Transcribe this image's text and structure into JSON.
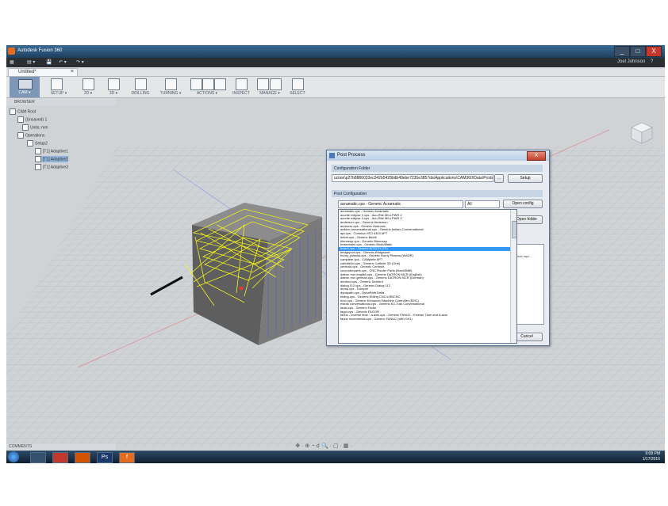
{
  "window": {
    "title": "Autodesk Fusion 360",
    "user": "Joel Johnson",
    "help": "?",
    "minimize": "_",
    "maximize": "□",
    "close": "X"
  },
  "menubar": {
    "grid": "▦",
    "file": "▤ ▾",
    "save": "💾",
    "undo": "↶ ▾",
    "redo": "↷ ▾"
  },
  "document_tab": {
    "label": "Untitled*",
    "close": "×"
  },
  "ribbon": {
    "workspace": "CAM ▾",
    "groups": [
      {
        "name": "setup",
        "label": "SETUP ▾"
      },
      {
        "name": "2d",
        "label": "2D ▾"
      },
      {
        "name": "3d",
        "label": "3D ▾"
      },
      {
        "name": "drilling",
        "label": "DRILLING"
      },
      {
        "name": "turning",
        "label": "TURNING ▾"
      },
      {
        "name": "actions",
        "label": "ACTIONS ▾"
      },
      {
        "name": "inspect",
        "label": "INSPECT"
      },
      {
        "name": "manage",
        "label": "MANAGE ▾"
      },
      {
        "name": "select",
        "label": "SELECT"
      }
    ]
  },
  "browser": {
    "title": "BROWSER",
    "items": [
      {
        "label": "CAM Root"
      },
      {
        "label": "(Unsaved) 1"
      },
      {
        "label": "Units: mm"
      },
      {
        "label": "Operations"
      },
      {
        "label": "Setup2"
      },
      {
        "label": "[T1] Adaptive1"
      },
      {
        "label": "[T1] Adaptive2"
      },
      {
        "label": "[T1] Adaptive3"
      }
    ]
  },
  "comments": {
    "label": "COMMENTS"
  },
  "navbar": {
    "tools": "✥ · ⊕ ◔ ☌ 🔍 · ▢ · ▦ ·"
  },
  "dialog": {
    "title": "Post Process",
    "close": "X",
    "config_folder_header": "Configuration Folder",
    "config_folder_path": "uction\\p27b8886033ec042b5428bdb49ebe7235e3857da\\Applications\\CAM360\\Data\\Posts",
    "browse_label": "...",
    "setup_button": "Setup",
    "post_config_header": "Post Configuration",
    "selected_config": "acramatic.cps - Generic Acramatic",
    "filter": "All",
    "open_config_button": "Open config",
    "open_folder_button": "Open folder",
    "side_text": "serve rapi...",
    "cancel_button": "Cancel",
    "options": [
      "acramatic.cps - Generic Acramatic",
      "acurite millpwr 2.cps - Acu-Rite MILLPWR 2",
      "acurite millpwr 3.cps - Acu-Rite MILLPWR 3",
      "anderson.cps - Generic Anderson",
      "andronic.cps - Generic Andronic",
      "anilam conversational.cps - Generic Anilam Conversational",
      "apt.cps - Common ISO 4343 APT",
      "beloit.cps - Generic Beloit",
      "biennesp.cps - Generic Biennesp",
      "bostomatic.cps - Generic BostoMatic",
      "bosch.cps - Generic BOSCH (TS)",
      "bridgeport.cps - Generic Bridgeport",
      "burny_plasma.cps - Generic Burny Plasma (WADR)",
      "camplete.cps - CAMplete APT",
      "carbide3d.cps - Generic Carbide 3D (Grbl)",
      "centroid.cps - Generic Centroid",
      "cncrouterparts.cps - CNC Router Parts (Mach3Mill)",
      "datron mcr english.cps - Generic DATRON MCR (English)",
      "datron mcr german.cps - Generic DATRON MCR (German)",
      "denford.cps - Generic Denford",
      "dialog 112.cps - Generic Dialog 112",
      "dump.cps - Dumper",
      "dynapath.cps - DynaPath Delta",
      "ebling.cps - Generic Ebling CNC/USBCNC",
      "emc.cps - Generic Enhanced Machine Controller (EMC)",
      "estrak conversational.cps - Generic EZ-Trak Conversational",
      "fadal.cps - Generic Fadal",
      "fagor.cps - Generic FAGOR",
      "fanuc - inverse time - a-axis.cps - Generic FANUC - Inverse Time and A-axis",
      "fanuc incremental.cps - Generic FANUC (with G91)"
    ],
    "selected_option_index": 10
  },
  "taskbar": {
    "apps": [
      "",
      "",
      "",
      "Ps",
      "f"
    ],
    "time": "9:08 PM",
    "date": "1/17/2016"
  },
  "colors": {
    "toolpath": "#f2f21a",
    "part": "#6e6e6e",
    "selection": "#3399ff",
    "cam_workspace": "#7d97b6"
  }
}
